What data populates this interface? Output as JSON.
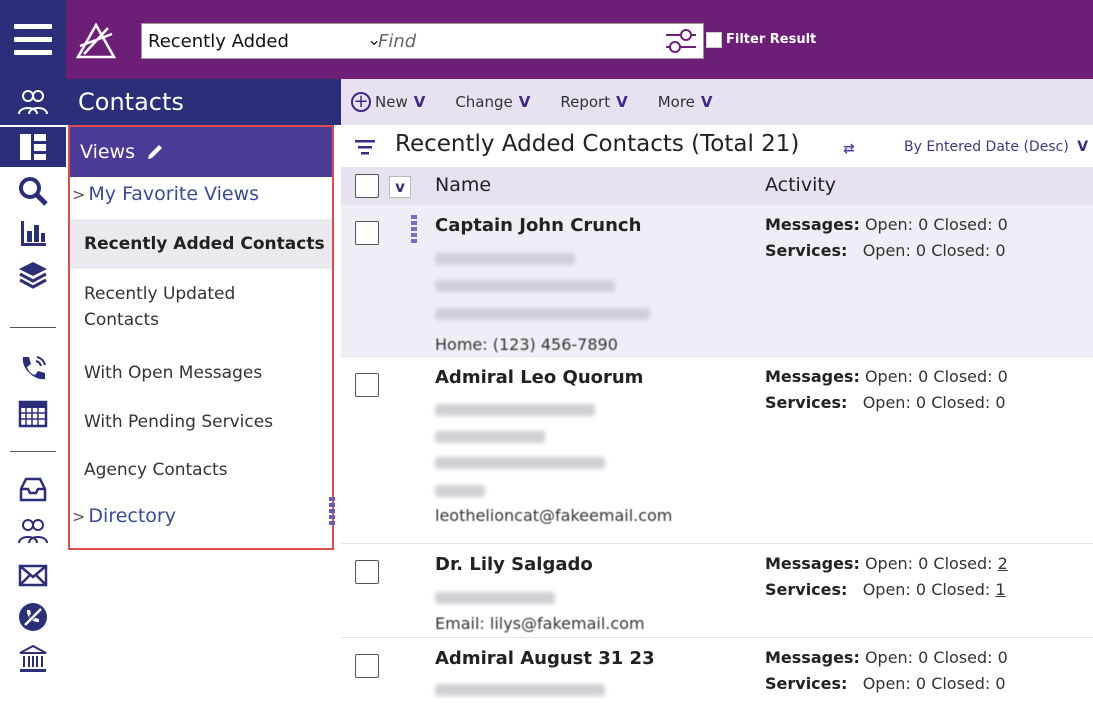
{
  "search": {
    "selected_view": "Recently Added",
    "placeholder": "Find",
    "filter_label": "Filter Result"
  },
  "leftpane": {
    "title": "Contacts",
    "views_title": "Views",
    "groups": [
      {
        "label": "My Favorite Views"
      },
      {
        "label": "Directory"
      }
    ],
    "items": [
      {
        "label": "Recently Added Contacts",
        "selected": true
      },
      {
        "label": "Recently Updated Contacts"
      },
      {
        "label": "With Open Messages"
      },
      {
        "label": "With Pending Services"
      },
      {
        "label": "Agency Contacts"
      }
    ]
  },
  "toolbar": {
    "new_label": "New",
    "change_label": "Change",
    "report_label": "Report",
    "more_label": "More"
  },
  "list": {
    "title": "Recently Added Contacts (Total 21)",
    "sort_label": "By Entered Date (Desc)",
    "columns": [
      "Name",
      "Activity"
    ],
    "messages_label": "Messages:",
    "services_label": "Services:",
    "rows": [
      {
        "name": "Captain John Crunch",
        "messages": {
          "open": "Open: 0",
          "closed_prefix": "Closed:",
          "closed": "0"
        },
        "services": {
          "open": "Open: 0",
          "closed_prefix": "Closed:",
          "closed": "0"
        },
        "visible_fragment": "Home: (123) 456-7890"
      },
      {
        "name": "Admiral Leo Quorum",
        "messages": {
          "open": "Open: 0",
          "closed_prefix": "Closed:",
          "closed": "0"
        },
        "services": {
          "open": "Open: 0",
          "closed_prefix": "Closed:",
          "closed": "0"
        },
        "visible_fragment": "leothelioncat@fakeemail.com"
      },
      {
        "name": "Dr. Lily Salgado",
        "messages": {
          "open": "Open: 0",
          "closed_prefix": "Closed:",
          "closed": "2"
        },
        "services": {
          "open": "Open: 0",
          "closed_prefix": "Closed:",
          "closed": "1"
        },
        "visible_fragment": "Email: lilys@fakemail.com"
      },
      {
        "name": "Admiral August 31 23",
        "messages": {
          "open": "Open: 0",
          "closed_prefix": "Closed:",
          "closed": "0"
        },
        "services": {
          "open": "Open: 0",
          "closed_prefix": "Closed:",
          "closed": "0"
        },
        "visible_fragment": ""
      }
    ]
  },
  "colors": {
    "topbar": "#6d1f78",
    "navy": "#2b2f7a",
    "views_header": "#4b3a96",
    "toolbar_bg": "#e8e2f0",
    "highlight_border": "#e04b4b"
  }
}
